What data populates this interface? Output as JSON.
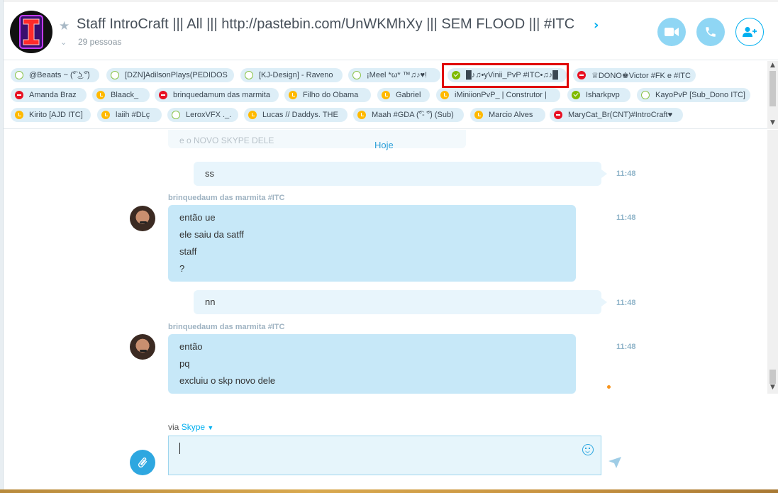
{
  "header": {
    "title": "Staff IntroCraft ||| All ||| http://pastebin.com/UnWKMhXy ||| SEM FLOOD ||| #ITC",
    "participants": "29 pessoas"
  },
  "participants": [
    {
      "name": "@Beaats ~ (͡° ͜ʖ ͡°)",
      "status": "offline"
    },
    {
      "name": "[DZN]AdilsonPlays(PEDIDOS",
      "status": "offline"
    },
    {
      "name": "[KJ-Design] - Raveno",
      "status": "offline"
    },
    {
      "name": "¡Meel *ω* ™♫♪♥!",
      "status": "offline"
    },
    {
      "name": "█♪♫•yVinii_PvP #ITC•♫♪█",
      "status": "online"
    },
    {
      "name": "♕DONO♚Victor #FK e #ITC",
      "status": "busy"
    },
    {
      "name": "Amanda Braz",
      "status": "busy"
    },
    {
      "name": "Blaack_",
      "status": "away"
    },
    {
      "name": "brinquedamum das marmita",
      "status": "busy"
    },
    {
      "name": "Filho do Obama",
      "status": "away"
    },
    {
      "name": "Gabriel",
      "status": "away"
    },
    {
      "name": "iMiniionPvP_ | Construtor |",
      "status": "away"
    },
    {
      "name": "Isharkpvp",
      "status": "online"
    },
    {
      "name": "KayoPvP [Sub_Dono ITC]",
      "status": "offline"
    },
    {
      "name": "Kirito [AJD ITC]",
      "status": "away"
    },
    {
      "name": "laiih #DLç",
      "status": "away"
    },
    {
      "name": "LeroxVFX ._.",
      "status": "offline"
    },
    {
      "name": "Lucas // Daddys. THE",
      "status": "away"
    },
    {
      "name": "Maah #GDA (͡°- ͡°) (Sub)",
      "status": "away"
    },
    {
      "name": "Marcio Alves",
      "status": "away"
    },
    {
      "name": "MaryCat_Br(CNT)#IntroCraft♥",
      "status": "busy"
    }
  ],
  "chat": {
    "ghost_text": "e o NOVO SKYPE DELE",
    "day_separator": "Hoje",
    "messages": [
      {
        "from": "me",
        "lines": [
          "ss"
        ],
        "time": "11:48"
      },
      {
        "from": "brinquedaum das marmita #ITC",
        "lines": [
          "então ue",
          "ele saiu da satff",
          "staff",
          "?"
        ],
        "time": "11:48"
      },
      {
        "from": "me",
        "lines": [
          "nn"
        ],
        "time": "11:48"
      },
      {
        "from": "brinquedaum das marmita #ITC",
        "lines": [
          "então",
          "pq",
          "excluiu o skp novo dele"
        ],
        "time": "11:48"
      }
    ]
  },
  "compose": {
    "via_prefix": "via",
    "via_link": "Skype",
    "value": ""
  },
  "colors": {
    "accent": "#00aff0",
    "bubble_theirs": "#c7e8f8",
    "bubble_mine": "#e8f5fc",
    "highlight": "#e00000"
  },
  "icons": [
    "star-icon",
    "video-call-icon",
    "phone-icon",
    "add-person-icon",
    "emoji-icon",
    "attach-icon",
    "send-icon",
    "chevron-right-icon",
    "chevron-down-icon"
  ]
}
